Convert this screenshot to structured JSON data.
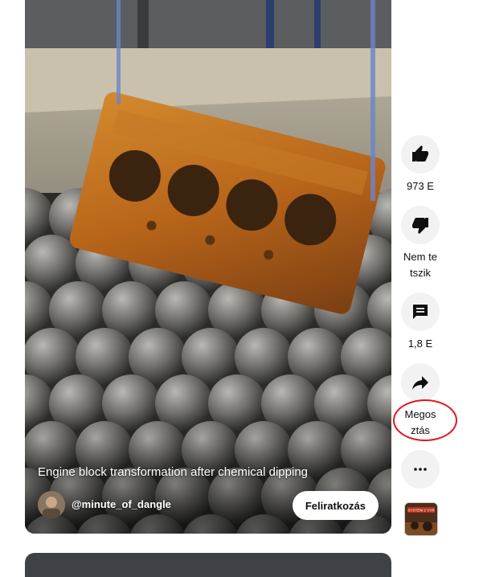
{
  "video": {
    "title": "Engine block transformation after chemical dipping",
    "channel_name": "@minute_of_dangle",
    "subscribe_label": "Feliratkozás"
  },
  "actions": {
    "like_count": "973 E",
    "dislike_label": "Nem tetszik",
    "comment_count": "1,8 E",
    "share_label": "Megos ztás"
  },
  "thumbnail": {
    "caption": "SYSTEM 2 VYR"
  },
  "colors": {
    "annotation_circle": "#e3161f",
    "subscribe_bg": "#ffffff",
    "action_bg": "#f2f2f2"
  },
  "icons": {
    "like": "thumb-up-icon",
    "dislike": "thumb-down-icon",
    "comment": "comment-icon",
    "share": "share-icon",
    "more": "more-horizontal-icon"
  }
}
